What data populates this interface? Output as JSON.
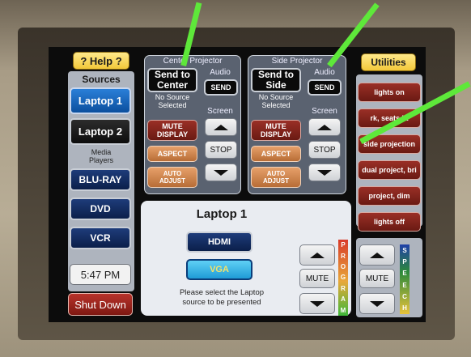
{
  "left": {
    "help_label": "? Help ?",
    "sources_header": "Sources",
    "laptop1": "Laptop 1",
    "laptop2": "Laptop 2",
    "media_players": "Media\nPlayers",
    "bluray": "BLU-RAY",
    "dvd": "DVD",
    "vcr": "VCR",
    "time": "5:47 PM",
    "shutdown": "Shut Down"
  },
  "center_projector": {
    "title": "Center Projector",
    "send_to": "Send to\nCenter",
    "status": "No Source\nSelected",
    "audio_label": "Audio",
    "send_label": "SEND",
    "screen_label": "Screen",
    "mute_display": "MUTE\nDISPLAY",
    "aspect": "ASPECT",
    "auto_adjust": "AUTO\nADJUST",
    "stop": "STOP"
  },
  "side_projector": {
    "title": "Side Projector",
    "send_to": "Send to\nSide",
    "status": "No Source\nSelected",
    "audio_label": "Audio",
    "send_label": "SEND",
    "screen_label": "Screen",
    "mute_display": "MUTE\nDISPLAY",
    "aspect": "ASPECT",
    "auto_adjust": "AUTO\nADJUST",
    "stop": "STOP"
  },
  "source_panel": {
    "title": "Laptop 1",
    "hdmi": "HDMI",
    "vga": "VGA",
    "instruction": "Please select the Laptop\nsource to be presented",
    "mute": "MUTE",
    "program_letters": [
      "P",
      "R",
      "O",
      "G",
      "R",
      "A",
      "M"
    ]
  },
  "right": {
    "utilities": "Utilities",
    "presets": [
      "lights on",
      "rk, seats lit",
      "side projection",
      "dual project, bri",
      "project, dim",
      "lights off"
    ],
    "mute": "MUTE",
    "speech_letters": [
      "S",
      "P",
      "E",
      "E",
      "C",
      "H"
    ]
  },
  "colors": {
    "annotation_arrow": "#5ee83a",
    "selected_source": "#1d6ed0",
    "vga_selected": "#35b3e8"
  }
}
